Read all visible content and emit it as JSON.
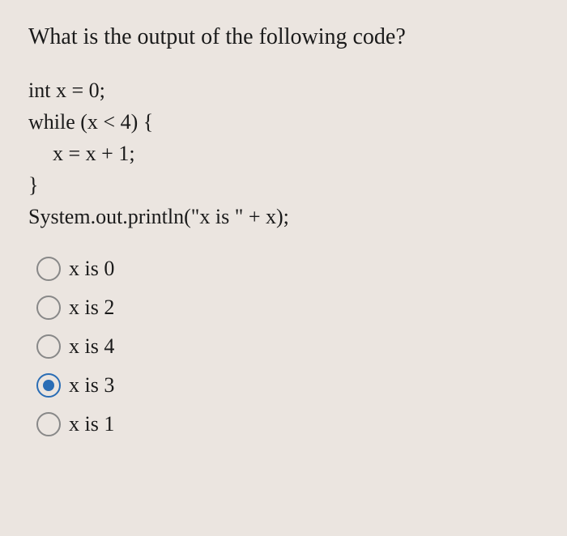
{
  "question": {
    "title": "What is the output of the following code?",
    "code": {
      "line1": "int x = 0;",
      "line2": "while (x < 4) {",
      "line3": "x = x + 1;",
      "line4": "}",
      "line5": "System.out.println(\"x is \" + x);"
    },
    "options": [
      {
        "label": "x is 0",
        "selected": false
      },
      {
        "label": "x is 2",
        "selected": false
      },
      {
        "label": "x is 4",
        "selected": false
      },
      {
        "label": "x is 3",
        "selected": true
      },
      {
        "label": "x is 1",
        "selected": false
      }
    ]
  }
}
